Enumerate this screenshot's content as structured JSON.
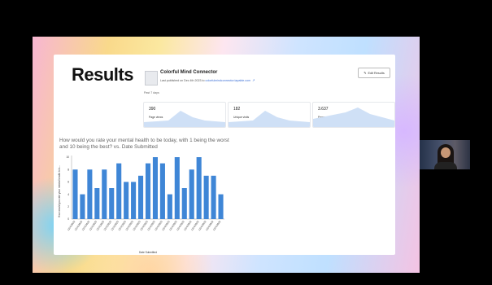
{
  "page": {
    "heading": "Results",
    "form_name": "Colorful Mind Connector",
    "published_text": "Last published on Dec 4th 2023 to",
    "published_link": "colorfulmindconnector.tapable.com",
    "edit_button": "Edit Results",
    "period": "Past 7 days",
    "stats": [
      {
        "value": "390",
        "label": "Page views"
      },
      {
        "value": "182",
        "label": "Unique visits"
      },
      {
        "value": "3.637",
        "label": "Pages views per visit (average)"
      }
    ]
  },
  "chart_data": {
    "type": "bar",
    "title": "How would you rate your mental health to be today, with 1 being the worst and 10 being the best? vs. Date Submitted",
    "xlabel": "Date Submitted",
    "ylabel": "How would you rate your mental health to b...",
    "ylim": [
      0,
      10
    ],
    "yticks": [
      0,
      2,
      4,
      6,
      8,
      10
    ],
    "categories": [
      "12/4/2023",
      "12/4/2023",
      "12/4/2023",
      "12/4/2023",
      "12/4/2023",
      "12/4/2023",
      "12/4/2023",
      "12/4/2023",
      "12/4/2023",
      "12/4/2023",
      "12/4/2023",
      "12/4/2023",
      "12/4/2023",
      "12/4/2023",
      "12/4/2023",
      "12/4/2023",
      "12/4/2023",
      "12/4/2023",
      "12/4/2023",
      "12/4/2023",
      "12/4/2023"
    ],
    "values": [
      8,
      4,
      8,
      5,
      8,
      5,
      9,
      6,
      6,
      7,
      9,
      10,
      9,
      4,
      10,
      5,
      8,
      10,
      7,
      7,
      4
    ],
    "bar_color": "#3f86d6",
    "grid": false
  },
  "colors": {
    "accent": "#3f86d6",
    "sparkline": "#cfe0f6"
  }
}
